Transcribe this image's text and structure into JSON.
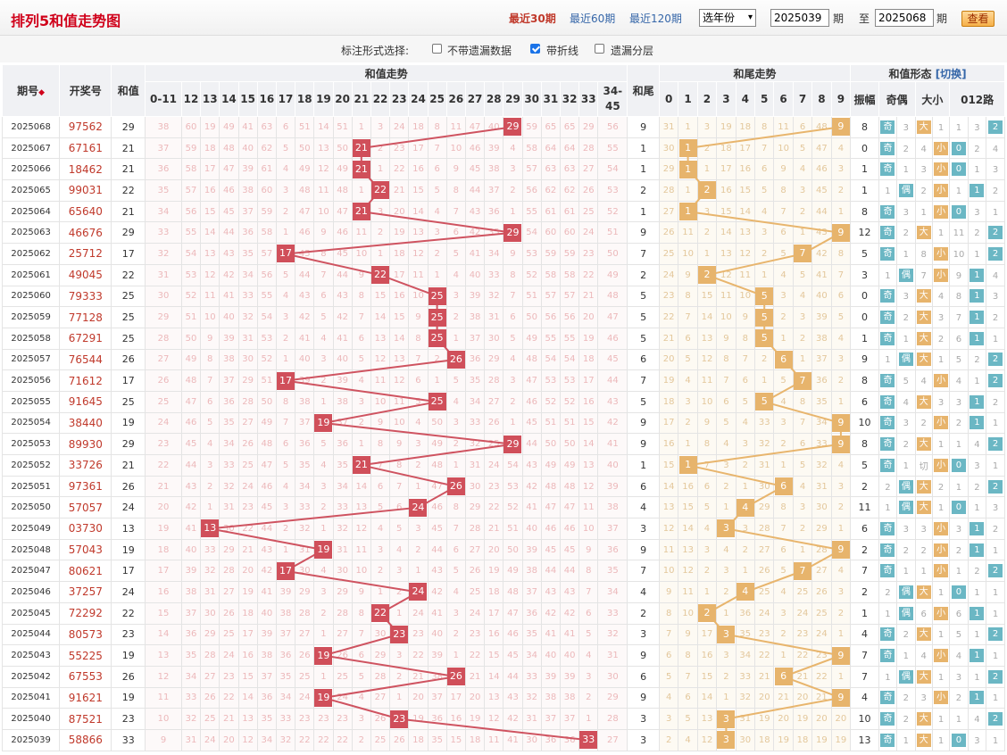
{
  "title": "排列5和值走势图",
  "quick": [
    "最近30期",
    "最近60期",
    "最近120期"
  ],
  "year_select": "选年份",
  "from": "2025039",
  "to": "2025068",
  "qi": "期",
  "zhi": "至",
  "query": "查看",
  "opt_label": "标注形式选择:",
  "opts": [
    {
      "label": "不带遗漏数据",
      "checked": false
    },
    {
      "label": "带折线",
      "checked": true
    },
    {
      "label": "遗漏分层",
      "checked": false
    }
  ],
  "headers": {
    "issue": "期号",
    "numbers": "开奖号",
    "sum": "和值",
    "sum_trend": "和值走势",
    "tail": "和尾",
    "tail_trend": "和尾走势",
    "shape": "和值形态",
    "switch": "[切换]",
    "amp": "振幅",
    "oe": "奇偶",
    "bs": "大小",
    "route": "012路"
  },
  "sum_cols": [
    "0-11",
    "12",
    "13",
    "14",
    "15",
    "16",
    "17",
    "18",
    "19",
    "20",
    "21",
    "22",
    "23",
    "24",
    "25",
    "26",
    "27",
    "28",
    "29",
    "30",
    "31",
    "32",
    "33",
    "34-45"
  ],
  "tail_cols": [
    "0",
    "1",
    "2",
    "3",
    "4",
    "5",
    "6",
    "7",
    "8",
    "9"
  ],
  "labels": {
    "odd": "奇",
    "even": "偶",
    "big": "大",
    "small": "小"
  },
  "rows": [
    {
      "issue": "2025068",
      "num": "97562",
      "sum": 29,
      "tail": 9,
      "amp": 8,
      "oe": "奇",
      "oe2": "3",
      "bs": "大",
      "bs2": "1",
      "r": [
        1,
        3,
        2
      ],
      "rs": 2
    },
    {
      "issue": "2025067",
      "num": "67161",
      "sum": 21,
      "tail": 1,
      "amp": 0,
      "oe": "奇",
      "oe2": "2",
      "bs": "小",
      "bs2": "4",
      "r": [
        0,
        2,
        4
      ],
      "rs": 0
    },
    {
      "issue": "2025066",
      "num": "18462",
      "sum": 21,
      "tail": 1,
      "amp": 1,
      "oe": "奇",
      "oe2": "1",
      "bs": "小",
      "bs2": "3",
      "r": [
        0,
        1,
        3
      ],
      "rs": 0
    },
    {
      "issue": "2025065",
      "num": "99031",
      "sum": 22,
      "tail": 2,
      "amp": 1,
      "oe": "偶",
      "oe2": "1",
      "bs": "小",
      "bs2": "2",
      "r": [
        1,
        1,
        2
      ],
      "rs": 1
    },
    {
      "issue": "2025064",
      "num": "65640",
      "sum": 21,
      "tail": 1,
      "amp": 8,
      "oe": "奇",
      "oe2": "3",
      "bs": "小",
      "bs2": "1",
      "r": [
        0,
        3,
        1
      ],
      "rs": 0
    },
    {
      "issue": "2025063",
      "num": "46676",
      "sum": 29,
      "tail": 9,
      "amp": 12,
      "oe": "奇",
      "oe2": "2",
      "bs": "大",
      "bs2": "1",
      "r": [
        11,
        2,
        2
      ],
      "rs": 2
    },
    {
      "issue": "2025062",
      "num": "25712",
      "sum": 17,
      "tail": 7,
      "amp": 5,
      "oe": "奇",
      "oe2": "1",
      "bs": "小",
      "bs2": "8",
      "r": [
        10,
        1,
        2
      ],
      "rs": 2
    },
    {
      "issue": "2025061",
      "num": "49045",
      "sum": 22,
      "tail": 2,
      "amp": 3,
      "oe": "偶",
      "oe2": "1",
      "bs": "小",
      "bs2": "7",
      "r": [
        9,
        1,
        4
      ],
      "rs": 1
    },
    {
      "issue": "2025060",
      "num": "79333",
      "sum": 25,
      "tail": 5,
      "amp": 0,
      "oe": "奇",
      "oe2": "3",
      "bs": "大",
      "bs2": "4",
      "r": [
        8,
        1,
        3
      ],
      "rs": 1
    },
    {
      "issue": "2025059",
      "num": "77128",
      "sum": 25,
      "tail": 5,
      "amp": 0,
      "oe": "奇",
      "oe2": "2",
      "bs": "大",
      "bs2": "3",
      "r": [
        7,
        1,
        2
      ],
      "rs": 1
    },
    {
      "issue": "2025058",
      "num": "67291",
      "sum": 25,
      "tail": 5,
      "amp": 1,
      "oe": "奇",
      "oe2": "1",
      "bs": "大",
      "bs2": "2",
      "r": [
        6,
        1,
        1
      ],
      "rs": 1
    },
    {
      "issue": "2025057",
      "num": "76544",
      "sum": 26,
      "tail": 6,
      "amp": 9,
      "oe": "偶",
      "oe2": "1",
      "bs": "大",
      "bs2": "1",
      "r": [
        5,
        2,
        2
      ],
      "rs": 2
    },
    {
      "issue": "2025056",
      "num": "71612",
      "sum": 17,
      "tail": 7,
      "amp": 8,
      "oe": "奇",
      "oe2": "5",
      "bs": "小",
      "bs2": "4",
      "r": [
        4,
        1,
        2
      ],
      "rs": 2
    },
    {
      "issue": "2025055",
      "num": "91645",
      "sum": 25,
      "tail": 5,
      "amp": 6,
      "oe": "奇",
      "oe2": "4",
      "bs": "大",
      "bs2": "3",
      "r": [
        3,
        1,
        2
      ],
      "rs": 1
    },
    {
      "issue": "2025054",
      "num": "38440",
      "sum": 19,
      "tail": 9,
      "amp": 10,
      "oe": "奇",
      "oe2": "3",
      "bs": "小",
      "bs2": "2",
      "r": [
        2,
        1,
        1
      ],
      "rs": 1
    },
    {
      "issue": "2025053",
      "num": "89930",
      "sum": 29,
      "tail": 9,
      "amp": 8,
      "oe": "奇",
      "oe2": "2",
      "bs": "大",
      "bs2": "1",
      "r": [
        1,
        4,
        2
      ],
      "rs": 2
    },
    {
      "issue": "2025052",
      "num": "33726",
      "sum": 21,
      "tail": 1,
      "amp": 5,
      "oe": "奇",
      "oe2": "1",
      "bs": "小",
      "bs2": "切",
      "r": [
        0,
        3,
        1
      ],
      "rs": 0
    },
    {
      "issue": "2025051",
      "num": "97361",
      "sum": 26,
      "tail": 6,
      "amp": 2,
      "oe": "偶",
      "oe2": "2",
      "bs": "大",
      "bs2": "2",
      "r": [
        1,
        2,
        2
      ],
      "rs": 2
    },
    {
      "issue": "2025050",
      "num": "57057",
      "sum": 24,
      "tail": 4,
      "amp": 11,
      "oe": "偶",
      "oe2": "1",
      "bs": "大",
      "bs2": "1",
      "r": [
        0,
        1,
        3
      ],
      "rs": 0
    },
    {
      "issue": "2025049",
      "num": "03730",
      "sum": 13,
      "tail": 3,
      "amp": 6,
      "oe": "奇",
      "oe2": "3",
      "bs": "小",
      "bs2": "3",
      "r": [
        3,
        1,
        2
      ],
      "rs": 1
    },
    {
      "issue": "2025048",
      "num": "57043",
      "sum": 19,
      "tail": 9,
      "amp": 2,
      "oe": "奇",
      "oe2": "2",
      "bs": "小",
      "bs2": "2",
      "r": [
        2,
        1,
        1
      ],
      "rs": 1
    },
    {
      "issue": "2025047",
      "num": "80621",
      "sum": 17,
      "tail": 7,
      "amp": 7,
      "oe": "奇",
      "oe2": "1",
      "bs": "小",
      "bs2": "1",
      "r": [
        1,
        2,
        2
      ],
      "rs": 2
    },
    {
      "issue": "2025046",
      "num": "37257",
      "sum": 24,
      "tail": 4,
      "amp": 2,
      "oe": "偶",
      "oe2": "2",
      "bs": "大",
      "bs2": "1",
      "r": [
        0,
        1,
        1
      ],
      "rs": 0
    },
    {
      "issue": "2025045",
      "num": "72292",
      "sum": 22,
      "tail": 2,
      "amp": 1,
      "oe": "偶",
      "oe2": "1",
      "bs": "小",
      "bs2": "6",
      "r": [
        6,
        1,
        1
      ],
      "rs": 1
    },
    {
      "issue": "2025044",
      "num": "80573",
      "sum": 23,
      "tail": 3,
      "amp": 4,
      "oe": "奇",
      "oe2": "2",
      "bs": "大",
      "bs2": "1",
      "r": [
        5,
        1,
        2
      ],
      "rs": 2
    },
    {
      "issue": "2025043",
      "num": "55225",
      "sum": 19,
      "tail": 9,
      "amp": 7,
      "oe": "奇",
      "oe2": "1",
      "bs": "小",
      "bs2": "4",
      "r": [
        4,
        1,
        1
      ],
      "rs": 1
    },
    {
      "issue": "2025042",
      "num": "67553",
      "sedum": 0,
      "sum": 26,
      "tail": 6,
      "amp": 7,
      "oe": "偶",
      "oe2": "1",
      "bs": "大",
      "bs2": "1",
      "r": [
        3,
        1,
        2
      ],
      "rs": 2
    },
    {
      "issue": "2025041",
      "num": "91621",
      "sum": 19,
      "tail": 9,
      "amp": 4,
      "oe": "奇",
      "oe2": "2",
      "bs": "小",
      "bs2": "3",
      "r": [
        2,
        1,
        1
      ],
      "rs": 1
    },
    {
      "issue": "2025040",
      "num": "87521",
      "sum": 23,
      "tail": 3,
      "amp": 10,
      "oe": "奇",
      "oe2": "2",
      "bs": "大",
      "bs2": "1",
      "r": [
        1,
        4,
        2
      ],
      "rs": 2
    },
    {
      "issue": "2025039",
      "num": "58866",
      "sum": 33,
      "tail": 3,
      "amp": 13,
      "oe": "奇",
      "oe2": "1",
      "bs": "大",
      "bs2": "1",
      "r": [
        0,
        3,
        1
      ],
      "rs": 0
    }
  ],
  "colors": {
    "ball_red": "#d04f5a",
    "ball_orange": "#e7b46c",
    "miss_text": "#ecb8ba",
    "header_bg": "#f0f1f4",
    "title": "#d0021b"
  }
}
